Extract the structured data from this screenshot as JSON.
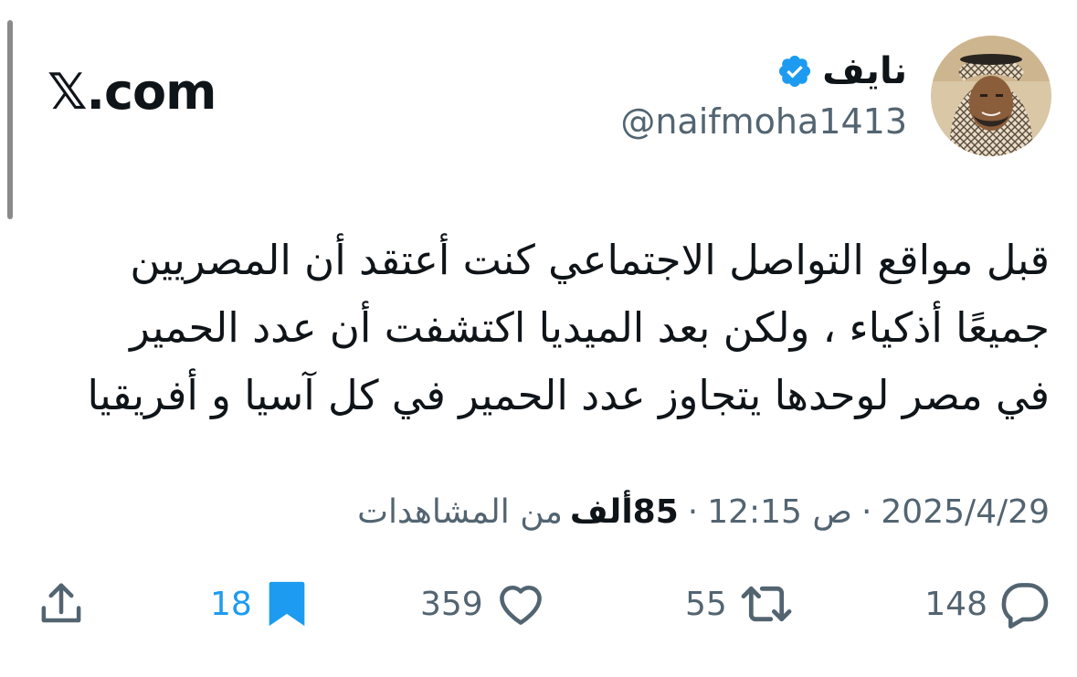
{
  "site": {
    "label": "𝕏.com"
  },
  "author": {
    "display_name": "نايف",
    "handle": "@naifmoha1413",
    "verified": true
  },
  "tweet": {
    "lines": [
      "قبل مواقع التواصل الاجتماعي كنت أعتقد أن المصريين",
      "جميعًا أذكياء ، ولكن بعد الميديا اكتشفت أن عدد الحمير",
      "في مصر لوحدها يتجاوز عدد الحمير في كل آسيا و أفريقيا"
    ]
  },
  "meta": {
    "date": "2025/4/29",
    "time": "12:15 ص",
    "views_count": "85ألف",
    "views_label": "من المشاهدات",
    "separator": "·"
  },
  "actions": {
    "replies": "148",
    "reposts": "55",
    "likes": "359",
    "bookmarks": "18"
  },
  "colors": {
    "text_primary": "#0f1419",
    "text_secondary": "#536471",
    "accent_blue": "#1d9bf0"
  },
  "icons": {
    "verified": "verified-badge-icon",
    "reply": "speech-bubble-icon",
    "repost": "repost-arrows-icon",
    "like": "heart-icon",
    "bookmark": "bookmark-icon",
    "share": "share-upload-icon"
  }
}
